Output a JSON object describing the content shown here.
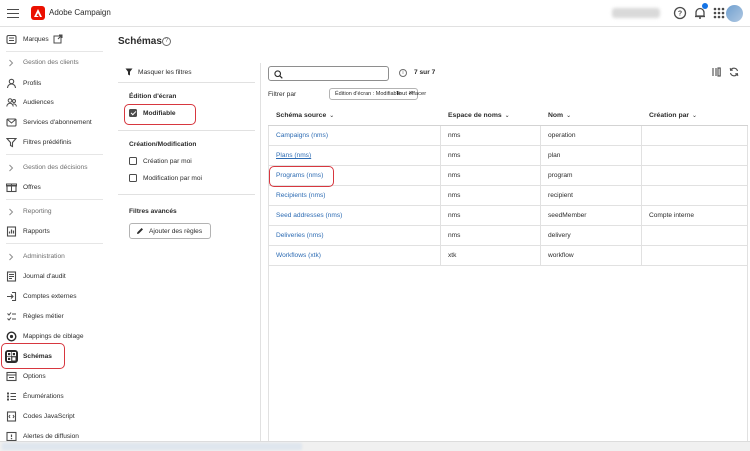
{
  "app": {
    "name": "Adobe Campaign"
  },
  "sidebar": {
    "top_item": {
      "label": "Marques",
      "icon": "brand-icon"
    },
    "sections": [
      {
        "title": "Gestion des clients",
        "items": [
          {
            "label": "Profils",
            "icon": "profile-icon"
          },
          {
            "label": "Audiences",
            "icon": "audience-icon"
          },
          {
            "label": "Services d'abonnement",
            "icon": "subscription-icon"
          },
          {
            "label": "Filtres prédéfinis",
            "icon": "filter-icon"
          }
        ]
      },
      {
        "title": "Gestion des décisions",
        "items": [
          {
            "label": "Offres",
            "icon": "offer-icon"
          }
        ]
      },
      {
        "title": "Reporting",
        "items": [
          {
            "label": "Rapports",
            "icon": "report-icon"
          }
        ]
      },
      {
        "title": "Administration",
        "items": [
          {
            "label": "Journal d'audit",
            "icon": "audit-icon"
          },
          {
            "label": "Comptes externes",
            "icon": "external-account-icon"
          },
          {
            "label": "Règles métier",
            "icon": "rules-icon"
          },
          {
            "label": "Mappings de ciblage",
            "icon": "targeting-icon"
          },
          {
            "label": "Schémas",
            "icon": "schema-icon",
            "active": true
          },
          {
            "label": "Options",
            "icon": "options-icon"
          },
          {
            "label": "Énumérations",
            "icon": "enumeration-icon"
          },
          {
            "label": "Codes JavaScript",
            "icon": "javascript-icon"
          },
          {
            "label": "Alertes de diffusion",
            "icon": "alert-icon"
          }
        ]
      }
    ]
  },
  "page": {
    "title": "Schémas"
  },
  "filters": {
    "hide_label": "Masquer les filtres",
    "screen_edit": {
      "title": "Édition d'écran",
      "options": [
        {
          "label": "Modifiable",
          "checked": true
        }
      ]
    },
    "creation": {
      "title": "Création/Modification",
      "options": [
        {
          "label": "Création par moi",
          "checked": false
        },
        {
          "label": "Modification par moi",
          "checked": false
        }
      ]
    },
    "advanced": {
      "title": "Filtres avancés",
      "add_rules_label": "Ajouter des règles"
    }
  },
  "toolbar": {
    "search_placeholder": "",
    "count": "7 sur 7",
    "filter_by_label": "Filtrer par",
    "active_filter_chip": "Édition d'écran : Modifiable",
    "clear_all_label": "Tout effacer"
  },
  "table": {
    "columns": [
      "Schéma source",
      "Espace de noms",
      "Nom",
      "Création par"
    ],
    "rows": [
      {
        "source": "Campaigns (nms)",
        "namespace": "nms",
        "name": "operation",
        "created_by": ""
      },
      {
        "source": "Plans (nms)",
        "namespace": "nms",
        "name": "plan",
        "created_by": ""
      },
      {
        "source": "Programs (nms)",
        "namespace": "nms",
        "name": "program",
        "created_by": ""
      },
      {
        "source": "Recipients (nms)",
        "namespace": "nms",
        "name": "recipient",
        "created_by": ""
      },
      {
        "source": "Seed addresses (nms)",
        "namespace": "nms",
        "name": "seedMember",
        "created_by": "Compte interne"
      },
      {
        "source": "Deliveries (nms)",
        "namespace": "nms",
        "name": "delivery",
        "created_by": ""
      },
      {
        "source": "Workflows (xtk)",
        "namespace": "xtk",
        "name": "workflow",
        "created_by": ""
      }
    ]
  },
  "colors": {
    "link": "#2c6bb3",
    "highlight": "#d7373f",
    "brand": "#eb1000"
  }
}
